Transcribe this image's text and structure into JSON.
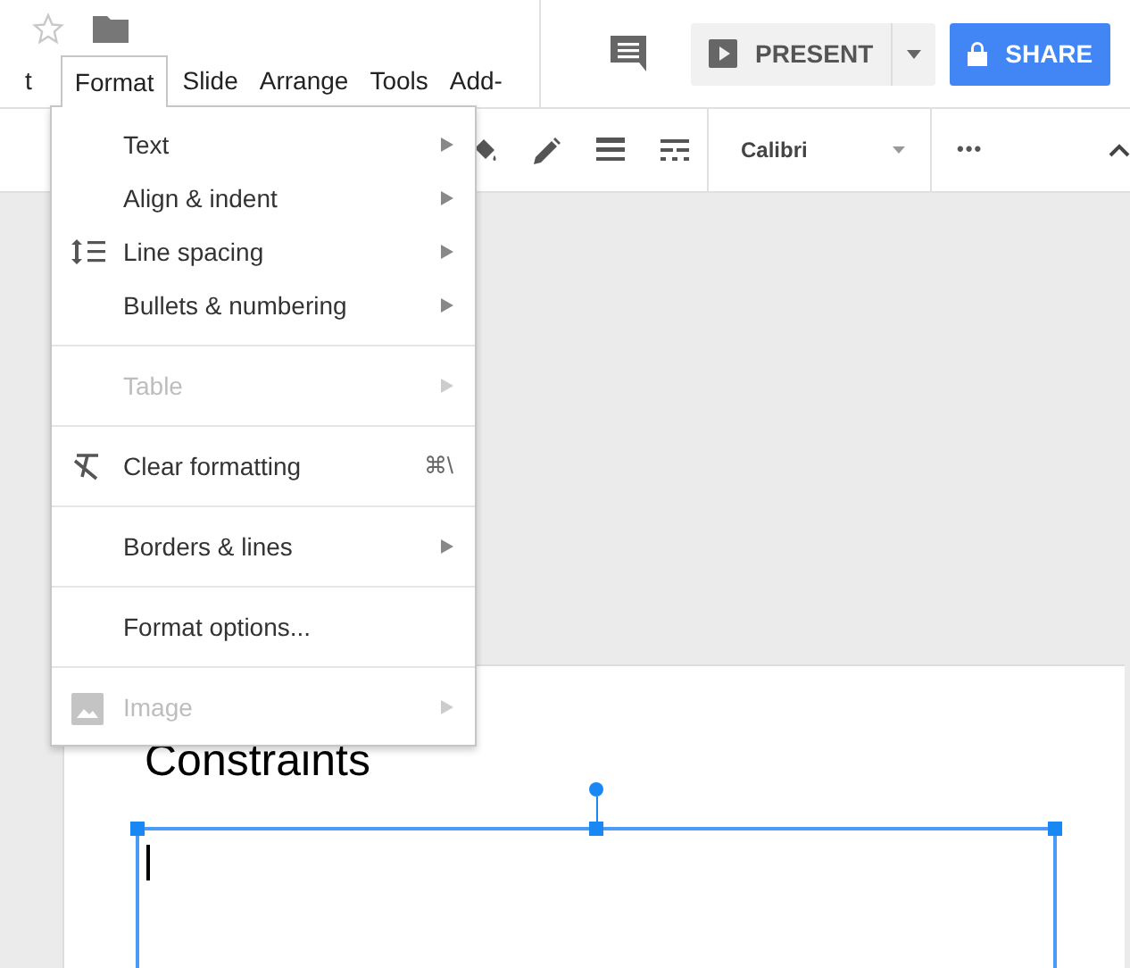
{
  "menu_bar": [
    {
      "label": "t",
      "selected": false
    },
    {
      "label": "Format",
      "selected": true
    },
    {
      "label": "Slide",
      "selected": false
    },
    {
      "label": "Arrange",
      "selected": false
    },
    {
      "label": "Tools",
      "selected": false
    },
    {
      "label": "Add-",
      "selected": false
    }
  ],
  "header": {
    "present": "PRESENT",
    "share": "SHARE"
  },
  "toolbar": {
    "font": "Calibri",
    "more": "•••"
  },
  "format_menu": [
    {
      "kind": "item",
      "label": "Text",
      "submenu": true,
      "disabled": false
    },
    {
      "kind": "item",
      "label": "Align & indent",
      "submenu": true,
      "disabled": false
    },
    {
      "kind": "item",
      "label": "Line spacing",
      "submenu": true,
      "disabled": false
    },
    {
      "kind": "item",
      "label": "Bullets & numbering",
      "submenu": true,
      "disabled": false
    },
    {
      "kind": "separator"
    },
    {
      "kind": "item",
      "label": "Table",
      "submenu": true,
      "disabled": true
    },
    {
      "kind": "separator"
    },
    {
      "kind": "item",
      "label": "Clear formatting",
      "submenu": false,
      "disabled": false,
      "shortcut": "⌘\\"
    },
    {
      "kind": "separator"
    },
    {
      "kind": "item",
      "label": "Borders & lines",
      "submenu": true,
      "disabled": false
    },
    {
      "kind": "separator"
    },
    {
      "kind": "item",
      "label": "Format options...",
      "submenu": false,
      "disabled": false
    },
    {
      "kind": "separator"
    },
    {
      "kind": "item",
      "label": "Image",
      "submenu": true,
      "disabled": true
    }
  ],
  "slide": {
    "title": "Constraints"
  }
}
